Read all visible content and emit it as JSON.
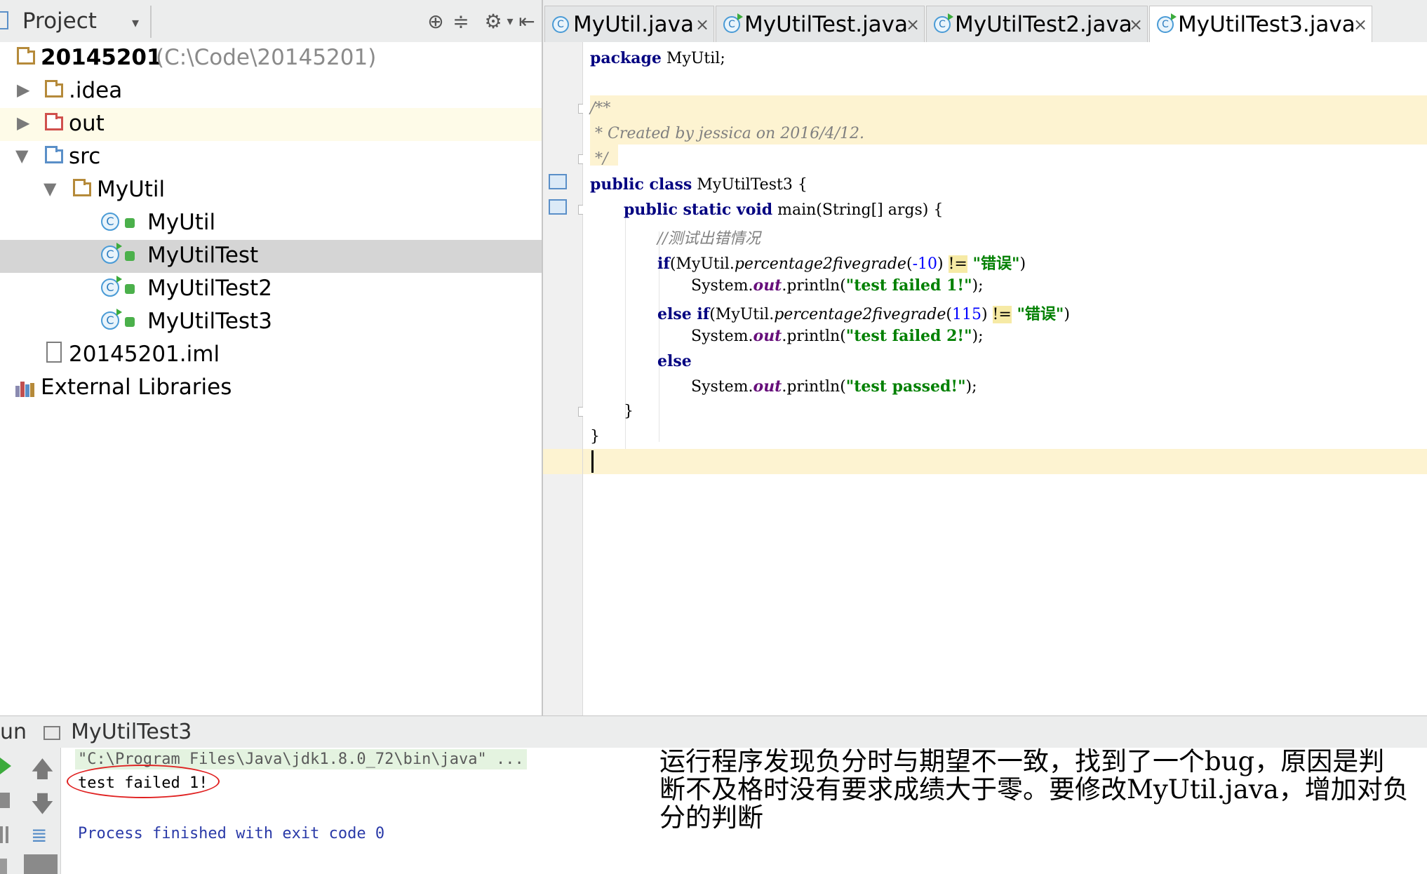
{
  "project_panel": {
    "title": "Project",
    "tree": [
      {
        "label": "20145201",
        "path": "(C:\\Code\\20145201)"
      },
      {
        "label": ".idea"
      },
      {
        "label": "out"
      },
      {
        "label": "src"
      },
      {
        "label": "MyUtil"
      },
      {
        "label": "MyUtil"
      },
      {
        "label": "MyUtilTest"
      },
      {
        "label": "MyUtilTest2"
      },
      {
        "label": "MyUtilTest3"
      },
      {
        "label": "20145201.iml"
      },
      {
        "label": "External Libraries"
      }
    ]
  },
  "tabs": [
    {
      "label": "MyUtil.java",
      "close": "×"
    },
    {
      "label": "MyUtilTest.java",
      "close": "×"
    },
    {
      "label": "MyUtilTest2.java",
      "close": "×"
    },
    {
      "label": "MyUtilTest3.java",
      "close": "×"
    }
  ],
  "code": {
    "l1_kw": "package",
    "l1_rest": " MyUtil;",
    "c1": "/**",
    "c2": " * Created by jessica on 2016/4/12.",
    "c3": " */",
    "l5_kw": "public class",
    "l5_rest": " MyUtilTest3 {",
    "l6_kw": "public static void",
    "l6_rest": " main(String[] args) {",
    "l7": "//测试出错情况",
    "l8_kw": "if",
    "l8_a": "(MyUtil.",
    "l8_m": "percentage2fivegrade",
    "l8_b": "(",
    "l8_n": "-10",
    "l8_c": ") ",
    "l8_op": "!=",
    "l8_s": " \"错误\"",
    "l8_d": ")",
    "l9_a": "System.",
    "l9_f": "out",
    "l9_b": ".println(",
    "l9_s": "\"test failed 1!\"",
    "l9_c": ");",
    "l10_kw": "else if",
    "l10_a": "(MyUtil.",
    "l10_m": "percentage2fivegrade",
    "l10_b": "(",
    "l10_n": "115",
    "l10_c": ") ",
    "l10_op": "!=",
    "l10_s": " \"错误\"",
    "l10_d": ")",
    "l11_a": "System.",
    "l11_f": "out",
    "l11_b": ".println(",
    "l11_s": "\"test failed 2!\"",
    "l11_c": ");",
    "l12_kw": "else",
    "l13_a": "System.",
    "l13_f": "out",
    "l13_b": ".println(",
    "l13_s": "\"test passed!\"",
    "l13_c": ");",
    "l14": "}",
    "l15": "}"
  },
  "run_panel": {
    "title_prefix": "un",
    "title": "MyUtilTest3",
    "console": [
      "\"C:\\Program Files\\Java\\jdk1.8.0_72\\bin\\java\" ...",
      "test failed 1!",
      "",
      "Process finished with exit code 0"
    ]
  },
  "annotation": "运行程序发现负分时与期望不一致，找到了一个bug，原因是判断不及格时没有要求成绩大于零。要修改MyUtil.java，增加对负分的判断",
  "colors": {
    "keyword": "#000080",
    "string": "#008000",
    "number": "#0000ff",
    "comment": "#808080",
    "highlight": "#fdf3d1",
    "annotation_circle": "#e02020"
  }
}
